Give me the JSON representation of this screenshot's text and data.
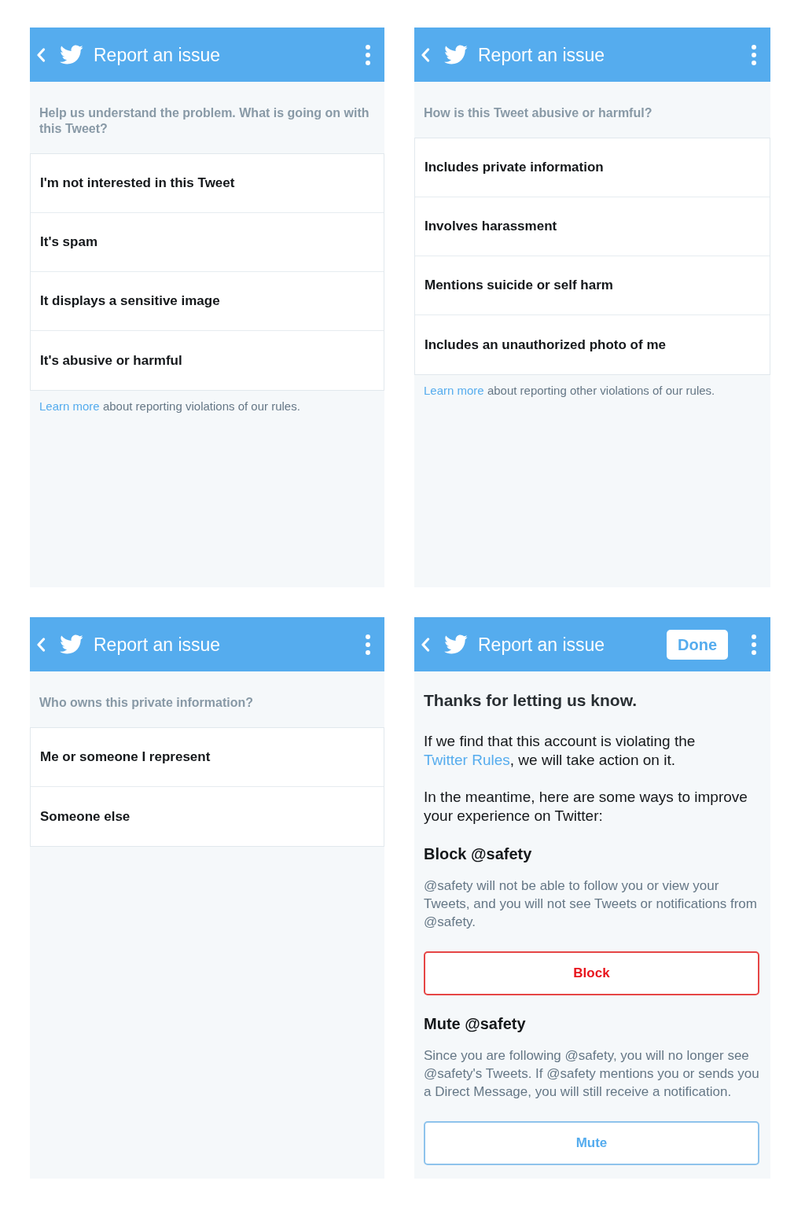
{
  "panels": [
    {
      "kind": "options",
      "header": {
        "title": "Report an issue"
      },
      "prompt": "Help us understand the problem. What is going on with this Tweet?",
      "options": [
        "I'm not interested in this Tweet",
        "It's spam",
        "It displays a sensitive image",
        "It's abusive or harmful"
      ],
      "footer": {
        "link": "Learn more",
        "text": " about reporting violations of our rules."
      }
    },
    {
      "kind": "options",
      "header": {
        "title": "Report an issue"
      },
      "prompt": "How is this Tweet abusive or harmful?",
      "options": [
        "Includes private information",
        "Involves harassment",
        "Mentions suicide or self harm",
        "Includes an unauthorized photo of me"
      ],
      "footer": {
        "link": "Learn more",
        "text": " about reporting other violations of our rules."
      }
    },
    {
      "kind": "options",
      "header": {
        "title": "Report an issue"
      },
      "prompt": "Who owns this private information?",
      "options": [
        "Me or someone I represent",
        "Someone else"
      ]
    },
    {
      "kind": "confirmation",
      "header": {
        "title": "Report an issue",
        "done_button": "Done"
      },
      "heading": "Thanks for letting us know.",
      "message": {
        "text_before": "If we find that this account is violating the ",
        "link": "Twitter Rules",
        "text_after": ", we will take action on it."
      },
      "intro": "In the meantime, here are some ways to improve your experience on Twitter:",
      "actions": [
        {
          "kind": "block",
          "title": "Block @safety",
          "description": "@safety will not be able to follow you or view your Tweets, and you will not see Tweets or notifications from @safety.",
          "button": "Block"
        },
        {
          "kind": "mute",
          "title": "Mute @safety",
          "description": "Since you are following @safety, you will no longer see @safety's Tweets. If @safety mentions you or sends you a Direct Message, you will still receive a notification.",
          "button": "Mute"
        }
      ]
    }
  ]
}
